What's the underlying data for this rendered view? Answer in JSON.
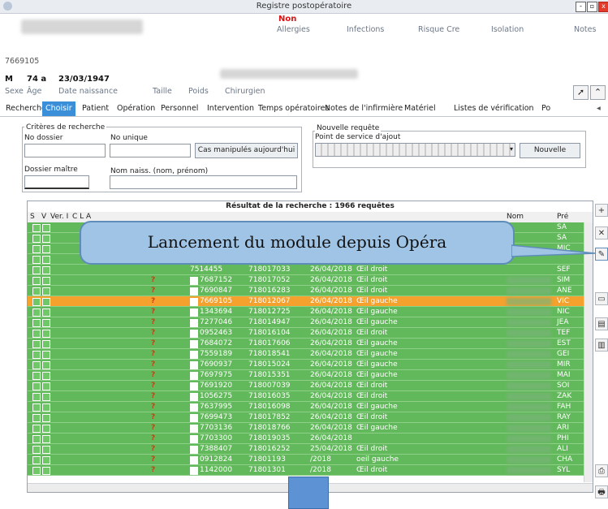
{
  "window": {
    "title": "Registre postopératoire",
    "min": "-",
    "max": "▫",
    "close": "x"
  },
  "patient": {
    "red_flag": "Non",
    "header_tabs": [
      "Allergies",
      "Infections",
      "Risque Cre",
      "Isolation",
      "Notes"
    ],
    "id": "7669105",
    "sexe_val": "M",
    "age_val": "74 a",
    "dob_val": "23/03/1947",
    "labels": [
      "Sexe",
      "Âge",
      "Date naissance",
      "Taille",
      "Poids",
      "Chirurgien"
    ]
  },
  "tabs": [
    "Recherche",
    "Choisir",
    "Patient",
    "Opération",
    "Personnel",
    "Intervention",
    "Temps opératoires",
    "Notes de l'infirmière",
    "Matériel",
    "Listes de vérification",
    "Po"
  ],
  "active_tab": "Choisir",
  "criteria": {
    "title": "Critères de recherche",
    "no_dossier": "No dossier",
    "no_unique": "No unique",
    "cas_btn": "Cas manipulés aujourd'hui",
    "dossier_maitre": "Dossier maître",
    "nom_naiss": "Nom naiss. (nom, prénom)"
  },
  "nouvelle": {
    "title": "Nouvelle requête",
    "point": "Point de service d'ajout",
    "btn": "Nouvelle"
  },
  "grid": {
    "caption": "Résultat de la recherche : 1966 requêtes",
    "headers": [
      "S",
      "V",
      "Ver. I",
      "C L A",
      "Nom",
      "Pré"
    ],
    "rows": [
      {
        "no": "7687152",
        "req": "718017052",
        "date": "26/04/2018",
        "site": "Œil droit",
        "pre": "SIM",
        "qm": "?"
      },
      {
        "no": "7690847",
        "req": "718016283",
        "date": "26/04/2018",
        "site": "Œil droit",
        "pre": "ANE",
        "qm": "?"
      },
      {
        "no": "7669105",
        "req": "718012067",
        "date": "26/04/2018",
        "site": "Œil gauche",
        "pre": "VIC",
        "qm": "?"
      },
      {
        "no": "1343694",
        "req": "718012725",
        "date": "26/04/2018",
        "site": "Œil gauche",
        "pre": "NIC",
        "qm": "?"
      },
      {
        "no": "7277046",
        "req": "718014947",
        "date": "26/04/2018",
        "site": "Œil gauche",
        "pre": "JEA",
        "qm": "?"
      },
      {
        "no": "0952463",
        "req": "718016104",
        "date": "26/04/2018",
        "site": "Œil droit",
        "pre": "TEF",
        "qm": "?"
      },
      {
        "no": "7684072",
        "req": "718017606",
        "date": "26/04/2018",
        "site": "Œil gauche",
        "pre": "EST",
        "qm": "?"
      },
      {
        "no": "7559189",
        "req": "718018541",
        "date": "26/04/2018",
        "site": "Œil gauche",
        "pre": "GEI",
        "qm": "?"
      },
      {
        "no": "7690937",
        "req": "718015024",
        "date": "26/04/2018",
        "site": "Œil gauche",
        "pre": "MIR",
        "qm": "?"
      },
      {
        "no": "7697975",
        "req": "718015351",
        "date": "26/04/2018",
        "site": "Œil gauche",
        "pre": "MAI",
        "qm": "?"
      },
      {
        "no": "7691920",
        "req": "718007039",
        "date": "26/04/2018",
        "site": "Œil droit",
        "pre": "SOI",
        "qm": "?"
      },
      {
        "no": "1056275",
        "req": "718016035",
        "date": "26/04/2018",
        "site": "Œil droit",
        "pre": "ZAK",
        "qm": "?"
      },
      {
        "no": "7637995",
        "req": "718016098",
        "date": "26/04/2018",
        "site": "Œil gauche",
        "pre": "FAH",
        "qm": "?"
      },
      {
        "no": "7699473",
        "req": "718017852",
        "date": "26/04/2018",
        "site": "Œil droit",
        "pre": "RAY",
        "qm": "?"
      },
      {
        "no": "7703136",
        "req": "718018766",
        "date": "26/04/2018",
        "site": "Œil gauche",
        "pre": "ARI",
        "qm": "?"
      },
      {
        "no": "7703300",
        "req": "718019035",
        "date": "26/04/2018",
        "site": "",
        "pre": "PHI",
        "qm": "?"
      },
      {
        "no": "7388407",
        "req": "718016252",
        "date": "25/04/2018",
        "site": "Œil droit",
        "pre": "ALI",
        "qm": "?"
      },
      {
        "no": "0912824",
        "req": "71801193",
        "date": "/2018",
        "site": "oeil gauche",
        "pre": "CHA",
        "qm": "?"
      },
      {
        "no": "1142000",
        "req": "71801301",
        "date": "/2018",
        "site": "Œil droit",
        "pre": "SYL",
        "qm": "?"
      }
    ],
    "top_pre": [
      "SA",
      "SA",
      "MIC",
      "",
      "SEF"
    ],
    "partial_row": {
      "no": "7514455",
      "req": "718017033",
      "date": "26/04/2018",
      "site": "Œil droit"
    }
  },
  "callout": "Lancement du module depuis Opéra",
  "right_toolbar": [
    "+",
    "✕",
    "✎",
    "▭",
    "▤",
    "▥",
    "⎙",
    "🖶"
  ]
}
